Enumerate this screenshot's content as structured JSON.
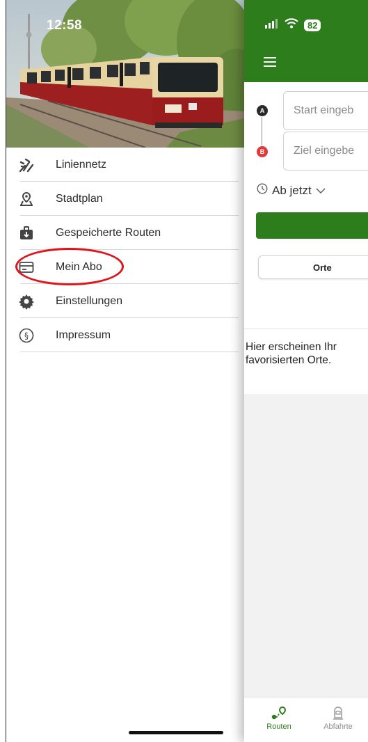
{
  "status_bar": {
    "time": "12:58",
    "battery": "82"
  },
  "drawer": {
    "items": [
      {
        "label": "Liniennetz",
        "icon": "network-map-icon"
      },
      {
        "label": "Stadtplan",
        "icon": "map-pin-icon"
      },
      {
        "label": "Gespeicherte Routen",
        "icon": "saved-routes-icon"
      },
      {
        "label": "Mein Abo",
        "icon": "ticket-card-icon"
      },
      {
        "label": "Einstellungen",
        "icon": "gear-icon"
      },
      {
        "label": "Impressum",
        "icon": "paragraph-icon"
      }
    ],
    "highlight_color": "#e0141a"
  },
  "main": {
    "accent_color": "#2e7d1d",
    "start_placeholder": "Start eingeb",
    "ziel_placeholder": "Ziel eingebe",
    "badge_a": "A",
    "badge_b": "B",
    "time_label": "Ab jetzt",
    "tab_orte": "Orte",
    "empty_line1": "Hier erscheinen Ihr",
    "empty_line2": "favorisierten Orte.",
    "nav": {
      "routen": "Routen",
      "abfahrten": "Abfahrte"
    }
  }
}
